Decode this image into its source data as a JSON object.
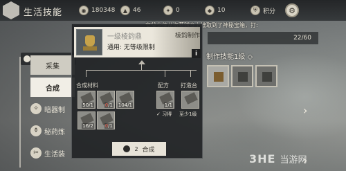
{
  "topbar": {
    "title": "生活技能",
    "resources": [
      {
        "icon": "coin-icon",
        "value": "180348"
      },
      {
        "icon": "silver-icon",
        "value": "46"
      },
      {
        "icon": "feather-icon",
        "value": "0"
      },
      {
        "icon": "token-icon",
        "value": "10"
      },
      {
        "icon": "shield-icon",
        "label": "积分"
      }
    ],
    "settings_icon": "gear-icon"
  },
  "announcement": "安爷少侠从盗墓贼身上搜取到了神秘宝箱，打:",
  "nav": {
    "vitality_label": "体力",
    "tabs": [
      "采集",
      "合成"
    ],
    "items": [
      {
        "label": "暗器制",
        "icon": "dart-icon"
      },
      {
        "label": "秘药炼",
        "icon": "medicine-icon"
      },
      {
        "label": "生活装",
        "icon": "tool-icon"
      }
    ]
  },
  "vitality_value": "22/60",
  "panel": {
    "item_name": "一级棱鈞鼎",
    "item_desc": "通用: 无等级限制",
    "item_tag": "棱鈞制作",
    "info_label": "i",
    "sections": {
      "materials": "合成材料",
      "recipe": "配方",
      "bench": "打造台"
    },
    "materials": [
      {
        "have": "50",
        "need": "1",
        "short": false
      },
      {
        "have": "0",
        "need": "1",
        "short": true
      },
      {
        "have": "104",
        "need": "1",
        "short": false
      },
      {
        "have": "16",
        "need": "2",
        "short": false
      },
      {
        "have": "0",
        "need": "1",
        "short": true
      }
    ],
    "recipe": {
      "count": "1/1",
      "status": "✓ 习得"
    },
    "bench": {
      "status": "至少1级"
    },
    "craft_button": {
      "label": "合成",
      "cost": "2"
    }
  },
  "skill_level": "制作技能1级 ◇",
  "watermark": {
    "logo": "3HE",
    "text": "当游网"
  }
}
